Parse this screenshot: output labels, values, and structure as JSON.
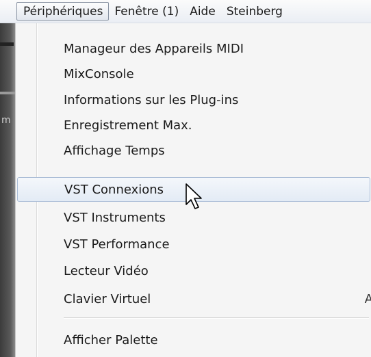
{
  "menubar": {
    "items": [
      {
        "label": "Périphériques"
      },
      {
        "label": "Fenêtre (1)"
      },
      {
        "label": "Aide"
      },
      {
        "label": "Steinberg"
      }
    ]
  },
  "dropdown": {
    "items": [
      {
        "label": "Manageur des Appareils MIDI"
      },
      {
        "label": "MixConsole"
      },
      {
        "label": "Informations sur les Plug-ins"
      },
      {
        "label": "Enregistrement Max."
      },
      {
        "label": "Affichage Temps"
      },
      {
        "label": "VST Connexions",
        "highlighted": true
      },
      {
        "label": "VST Instruments"
      },
      {
        "label": "VST Performance"
      },
      {
        "label": "Lecteur Vidéo"
      },
      {
        "label": "Clavier Virtuel",
        "shortcut": "A"
      },
      {
        "label": "Afficher Palette"
      }
    ]
  },
  "colors": {
    "highlight_border": "#a9bcd6",
    "menu_background": "#f5f5f5"
  }
}
